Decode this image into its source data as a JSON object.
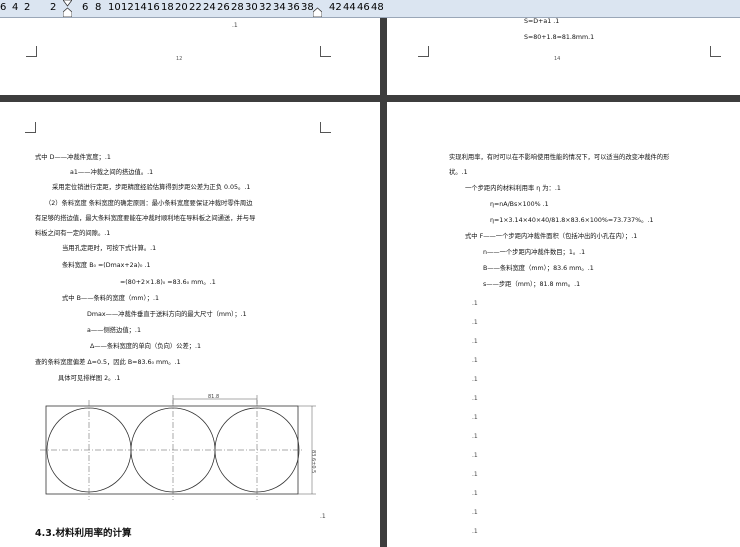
{
  "ruler": {
    "ticks": [
      "6",
      "4",
      "2",
      "2",
      "6",
      "8",
      "10",
      "12",
      "14",
      "16",
      "18",
      "20",
      "22",
      "24",
      "26",
      "28",
      "30",
      "32",
      "34",
      "36",
      "38",
      "42",
      "44",
      "46",
      "48"
    ]
  },
  "page_top_left": {
    "page_number": "12",
    "para_mark": ".1"
  },
  "page_top_right": {
    "line1": "S=D+a1  .1",
    "line2": "S=80+1.8=81.8mm.1",
    "page_number": "14"
  },
  "page_left": {
    "lines": [
      "式中 D——冲裁件宽度；.1",
      "a1——冲裁之间的搭边值。.1",
      "采用定位销进行定距，步距精度经验估算得到步距公差为正负 0.05。.1",
      "（2）条料宽度 条料宽度的确定原则：最小条料宽度要保证冲裁时零件周边",
      "有足够的搭边值，最大条料宽度要能在冲裁时顺利地在导料板之间通送，并与导",
      "料板之间有一定的间隙。.1",
      "当用孔定距时，可按下式计算。.1",
      "条料宽度   B₀ =(Dmax+2a)₀ .1",
      "=(80+2×1.8)₀ =83.6₀ mm。.1",
      "式中 B——条料的宽度（mm）；.1",
      "Dmax——冲裁件垂直于送料方向的最大尺寸（mm）；.1",
      "a——侧搭边值；.1",
      "Δ——条料宽度的单向（负向）公差；.1",
      "查的条料宽度偏差 Δ=0.5，因此 B=83.6₀ mm。.1",
      "具体可见排样图 2。.1"
    ],
    "figure": {
      "dim_top": "81.8",
      "dim_side": "83.6±0.5"
    },
    "para_mark": ".1",
    "section_heading": "4.3.材料利用率的计算"
  },
  "page_right": {
    "lines": [
      "实现利用率，有时可以在不影响使用性能的情况下，可以适当的改变冲裁件的形",
      "状。.1",
      "一个步距内的材料利用率 η 为：.1",
      "η=nA/Bs×100% .1",
      "η=1×3.14×40×40/81.8×83.6×100%=73.737%。.1",
      "式中 F——一个步距内冲裁件面积（包括冲出的小孔在内）；.1",
      "n——一个步距内冲裁件数目；1。.1",
      "B——条料宽度（mm）；83.6 mm。.1",
      "s——步距（mm）；81.8 mm。.1"
    ],
    "para_mark": ".1"
  }
}
